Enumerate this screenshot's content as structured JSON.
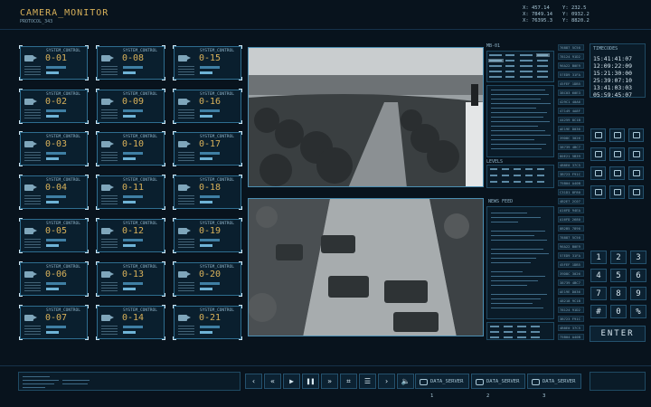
{
  "header": {
    "title": "CAMERA_MONITOR",
    "subtitle": "PROTOCOL_343",
    "coordinates": [
      {
        "label": "X",
        "value": "457.14"
      },
      {
        "label": "Y",
        "value": "232.5"
      },
      {
        "label": "X",
        "value": "7849.14"
      },
      {
        "label": "Y",
        "value": "0932.2"
      },
      {
        "label": "X",
        "value": "76395.3"
      },
      {
        "label": "Y",
        "value": "8820.2"
      }
    ]
  },
  "cameras": {
    "system_label": "SYSTEM_CONTROL",
    "items": [
      "0-01",
      "0-08",
      "0-15",
      "0-02",
      "0-09",
      "0-16",
      "0-03",
      "0-10",
      "0-17",
      "0-04",
      "0-11",
      "0-18",
      "0-05",
      "0-12",
      "0-19",
      "0-06",
      "0-13",
      "0-20",
      "0-07",
      "0-14",
      "0-21"
    ]
  },
  "middle_panel": {
    "title": "MB-01",
    "levels_label": "LEVELS",
    "news_feed_label": "NEWS FEED"
  },
  "ids": [
    "76887 5C50",
    "78124 91D2",
    "96A22 B0E9",
    "57ED9 31FA",
    "45FEF 1DB5",
    "38C03 60E3",
    "429C1 40A6",
    "47149 4A8F",
    "44259 8C1B",
    "AE19E D036",
    "39D8C 3026",
    "38739 4BC7",
    "80E21 5B39",
    "4B8E0 37C5",
    "3B723 F91C",
    "75B04 A40B",
    "C31D1 8F80",
    "4B2E7 2C07",
    "A16FD 94EA",
    "A16FD 2680",
    "8B2B5 7890",
    "78887 5C50",
    "96A22 B0E9",
    "57ED9 31FA",
    "45FEF 1DB5",
    "39D8C 3026",
    "38739 4BC7",
    "AE19E D036",
    "48218 9C1B",
    "78124 91D2",
    "3B723 F91C",
    "4B8E0 37C5",
    "75B04 A40B"
  ],
  "timecodes": {
    "title": "TIMECODES",
    "values": [
      "15:41:41:07",
      "12:09:22:09",
      "15:21:30:00",
      "25:39:07:10",
      "13:41:03:03",
      "05:59:45:07"
    ]
  },
  "keypad": {
    "keys": [
      "1",
      "2",
      "3",
      "4",
      "5",
      "6",
      "7",
      "8",
      "9",
      "#",
      "0",
      "%"
    ],
    "enter_label": "ENTER"
  },
  "icon_grid": [
    "grid-icon",
    "globe-icon",
    "frame-icon",
    "image-icon",
    "target-icon",
    "camera-icon",
    "id-card-icon",
    "eye-icon",
    "user-icon",
    "chat-icon",
    "search-icon",
    "document-icon"
  ],
  "controls": {
    "buttons": [
      {
        "name": "prev-button",
        "glyph": "‹"
      },
      {
        "name": "rewind-button",
        "glyph": "«"
      },
      {
        "name": "play-button",
        "glyph": "▶"
      },
      {
        "name": "pause-button",
        "glyph": "❚❚"
      },
      {
        "name": "fast-forward-button",
        "glyph": "»"
      },
      {
        "name": "crop-button",
        "glyph": "⌗"
      },
      {
        "name": "equalizer-button",
        "glyph": "☰"
      },
      {
        "name": "next-button",
        "glyph": "›"
      },
      {
        "name": "volume-button",
        "glyph": "🔈"
      }
    ],
    "servers": [
      "DATA_SERVER 1",
      "DATA_SERVER 2",
      "DATA_SERVER 3"
    ]
  },
  "colors": {
    "accent": "#d8b15a",
    "frame": "#2e6d8f",
    "background": "#08131d"
  }
}
